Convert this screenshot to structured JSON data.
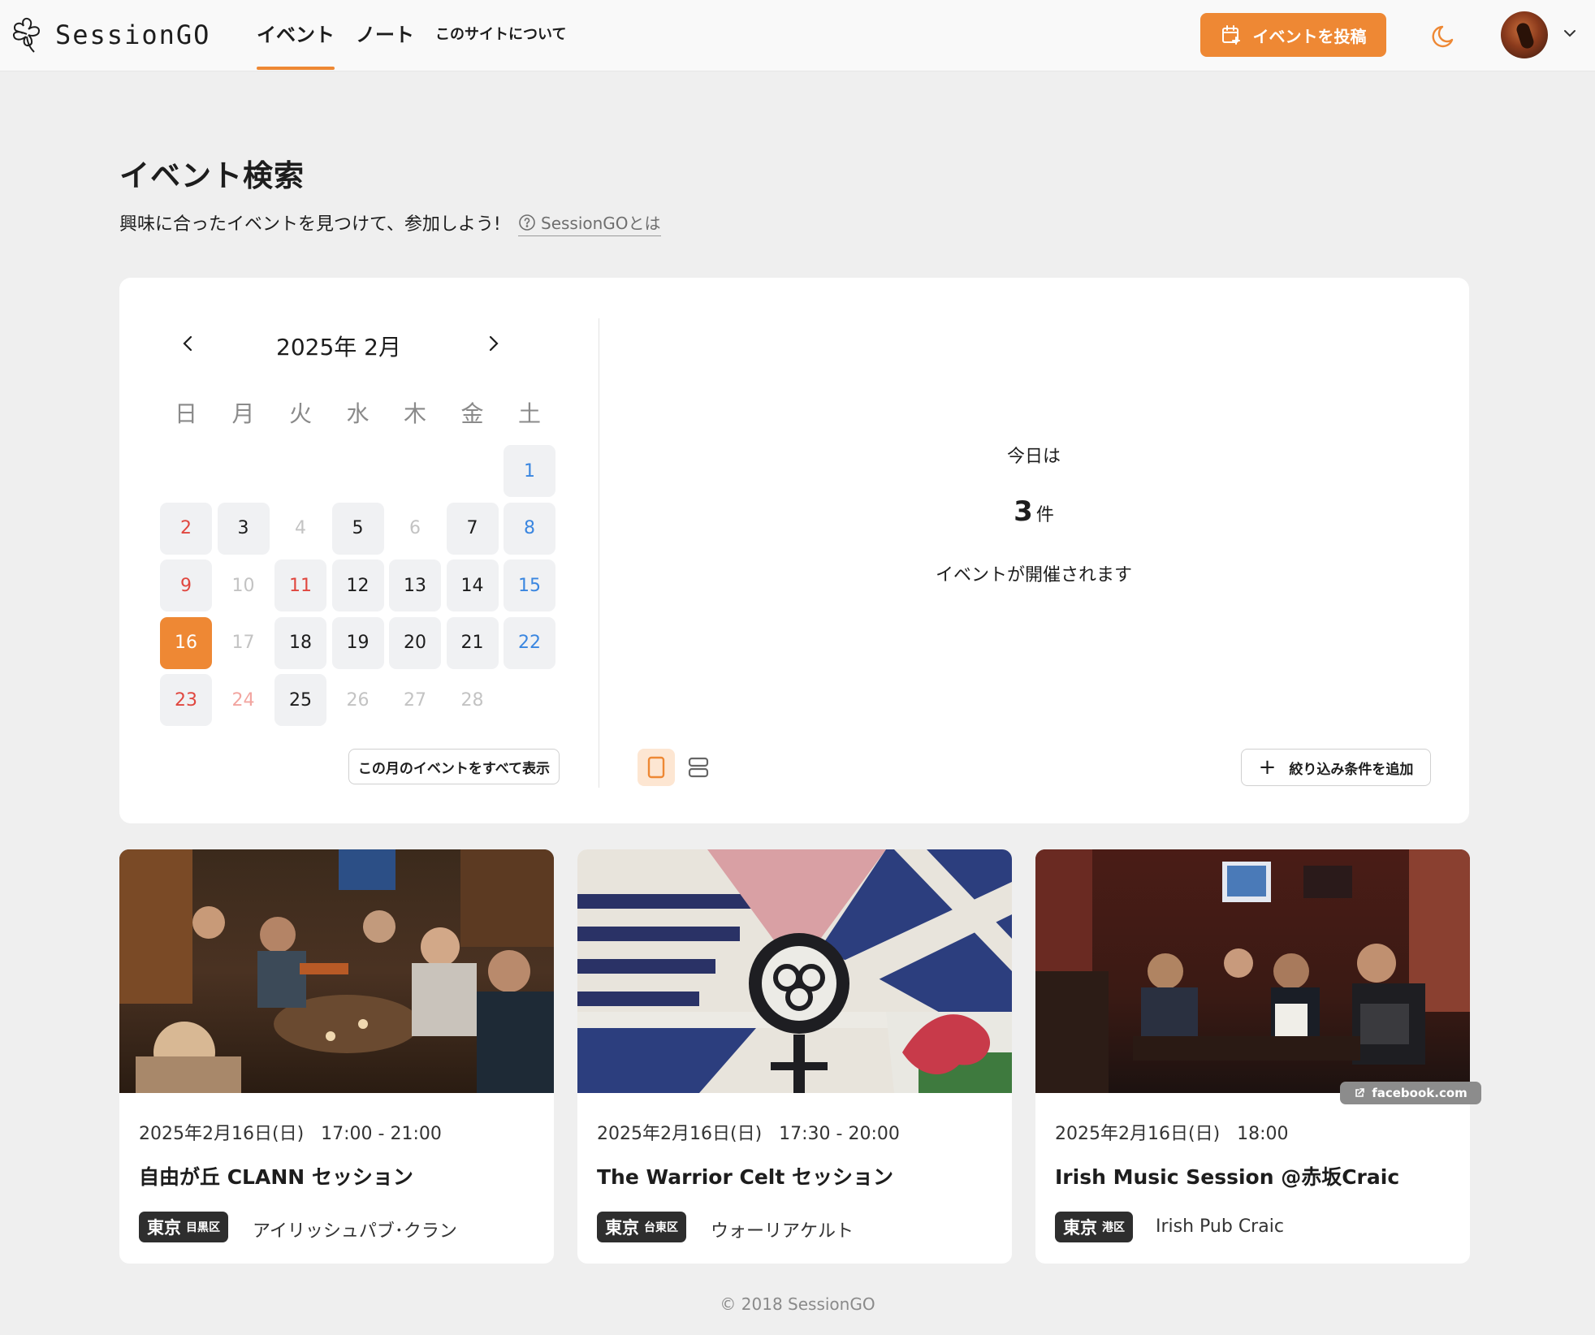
{
  "header": {
    "logo_text": "SessionGO",
    "nav": [
      {
        "label": "イベント",
        "active": true
      },
      {
        "label": "ノート",
        "active": false
      },
      {
        "label": "このサイトについて",
        "active": false
      }
    ],
    "post_button": "イベントを投稿",
    "accent_color": "#ee8834"
  },
  "hero": {
    "title": "イベント検索",
    "subtitle": "興味に合ったイベントを見つけて、参加しよう!",
    "about_link": "SessionGOとは"
  },
  "calendar": {
    "month_label": "2025年 2月",
    "weekdays": [
      "日",
      "月",
      "火",
      "水",
      "木",
      "金",
      "土"
    ],
    "days": [
      {
        "day": "1",
        "color": "blue",
        "has_event": true,
        "today": false
      },
      {
        "day": "2",
        "color": "red",
        "has_event": true,
        "today": false
      },
      {
        "day": "3",
        "color": "black",
        "has_event": true,
        "today": false
      },
      {
        "day": "4",
        "color": "gray",
        "has_event": false,
        "today": false
      },
      {
        "day": "5",
        "color": "black",
        "has_event": true,
        "today": false
      },
      {
        "day": "6",
        "color": "gray",
        "has_event": false,
        "today": false
      },
      {
        "day": "7",
        "color": "black",
        "has_event": true,
        "today": false
      },
      {
        "day": "8",
        "color": "blue",
        "has_event": true,
        "today": false
      },
      {
        "day": "9",
        "color": "red",
        "has_event": true,
        "today": false
      },
      {
        "day": "10",
        "color": "gray",
        "has_event": false,
        "today": false
      },
      {
        "day": "11",
        "color": "red",
        "has_event": true,
        "today": false
      },
      {
        "day": "12",
        "color": "black",
        "has_event": true,
        "today": false
      },
      {
        "day": "13",
        "color": "black",
        "has_event": true,
        "today": false
      },
      {
        "day": "14",
        "color": "black",
        "has_event": true,
        "today": false
      },
      {
        "day": "15",
        "color": "blue",
        "has_event": true,
        "today": false
      },
      {
        "day": "16",
        "color": "white",
        "has_event": true,
        "today": true
      },
      {
        "day": "17",
        "color": "gray",
        "has_event": false,
        "today": false
      },
      {
        "day": "18",
        "color": "black",
        "has_event": true,
        "today": false
      },
      {
        "day": "19",
        "color": "black",
        "has_event": true,
        "today": false
      },
      {
        "day": "20",
        "color": "black",
        "has_event": true,
        "today": false
      },
      {
        "day": "21",
        "color": "black",
        "has_event": true,
        "today": false
      },
      {
        "day": "22",
        "color": "blue",
        "has_event": true,
        "today": false
      },
      {
        "day": "23",
        "color": "red",
        "has_event": true,
        "today": false
      },
      {
        "day": "24",
        "color": "pink",
        "has_event": false,
        "today": false
      },
      {
        "day": "25",
        "color": "black",
        "has_event": true,
        "today": false
      },
      {
        "day": "26",
        "color": "gray",
        "has_event": false,
        "today": false
      },
      {
        "day": "27",
        "color": "gray",
        "has_event": false,
        "today": false
      },
      {
        "day": "28",
        "color": "gray",
        "has_event": false,
        "today": false
      }
    ],
    "show_all_button": "この月のイベントをすべて表示"
  },
  "today": {
    "label": "今日は",
    "count": "3",
    "unit": "件",
    "description": "イベントが開催されます"
  },
  "filter_button": "絞り込み条件を追加",
  "events": [
    {
      "date": "2025年2月16日(日)",
      "time": "17:00 - 21:00",
      "title": "自由が丘 CLANN セッション",
      "pref": "東京",
      "ward": "目黒区",
      "venue": "アイリッシュパブ･クラン"
    },
    {
      "date": "2025年2月16日(日)",
      "time": "17:30 - 20:00",
      "title": "The Warrior Celt セッション",
      "pref": "東京",
      "ward": "台東区",
      "venue": "ウォーリアケルト"
    },
    {
      "date": "2025年2月16日(日)",
      "time": "18:00",
      "title": "Irish Music Session @赤坂Craic",
      "pref": "東京",
      "ward": "港区",
      "venue": "Irish Pub Craic"
    }
  ],
  "source_tag": "facebook.com",
  "footer": "© 2018 SessionGO"
}
